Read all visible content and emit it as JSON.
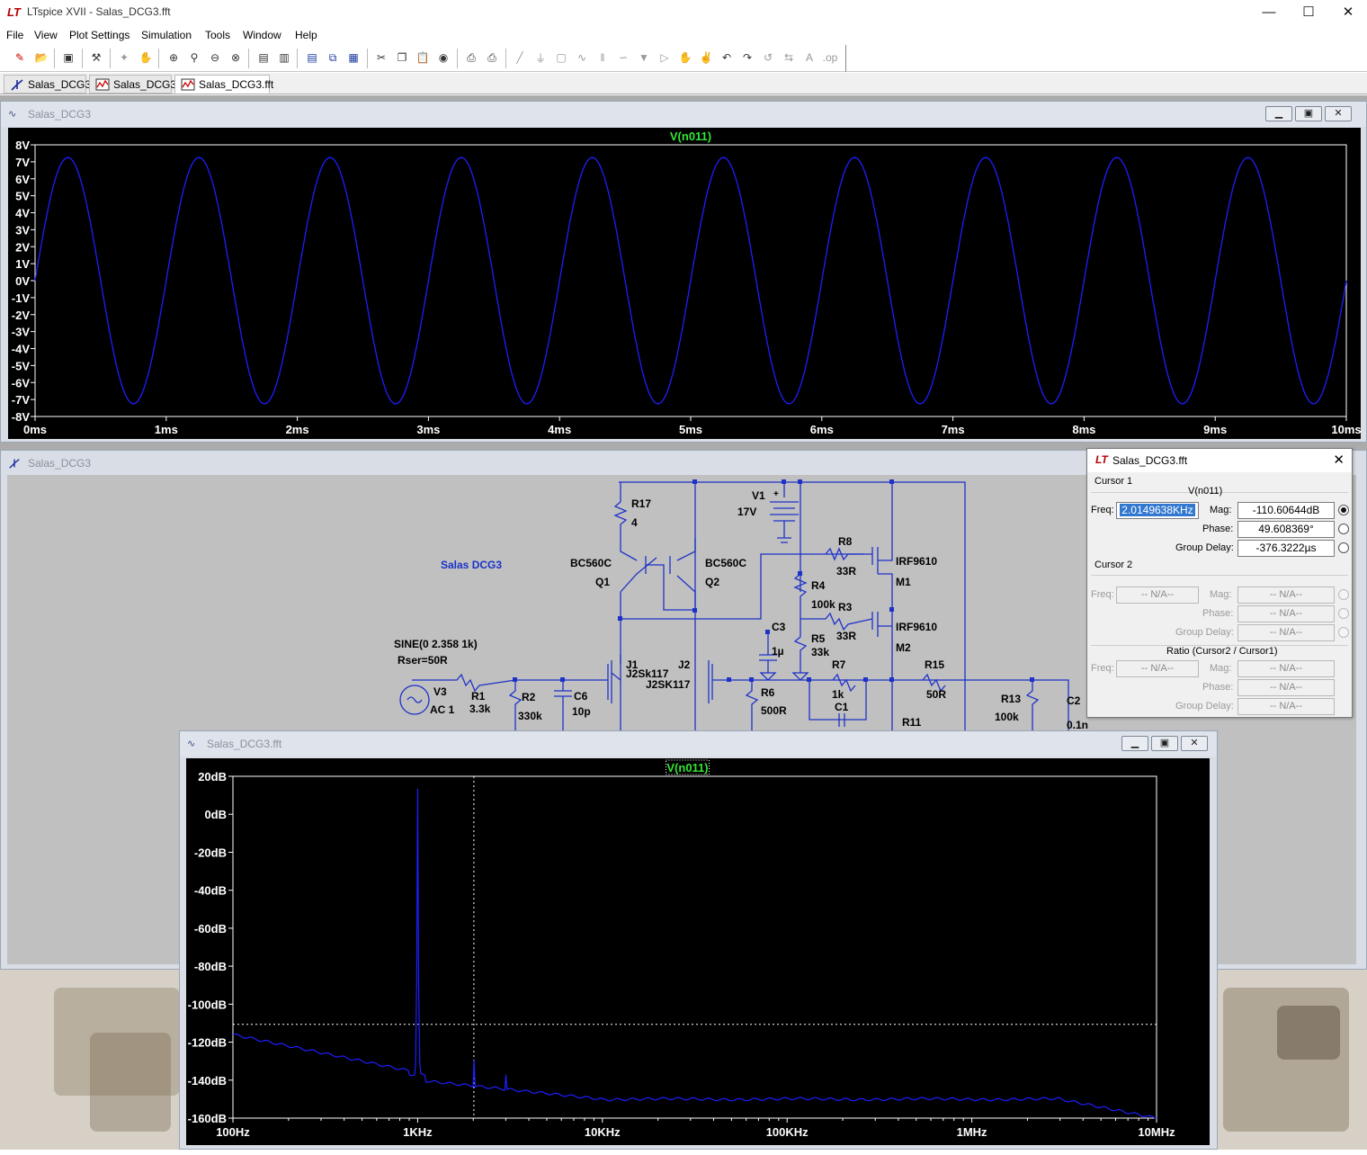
{
  "window": {
    "title": "LTspice XVII - Salas_DCG3.fft",
    "controls": [
      "minimize-icon",
      "maximize-icon",
      "close-icon"
    ]
  },
  "menu": [
    "File",
    "View",
    "Plot Settings",
    "Simulation",
    "Tools",
    "Window",
    "Help"
  ],
  "tabs": [
    {
      "label": "Salas_DCG3",
      "icon": "schematic-icon",
      "active": false
    },
    {
      "label": "Salas_DCG3",
      "icon": "waveform-icon",
      "active": false
    },
    {
      "label": "Salas_DCG3.fft",
      "icon": "waveform-icon",
      "active": true
    }
  ],
  "time_plot": {
    "window_title": "Salas_DCG3",
    "trace_label": "V(n011)",
    "trace_color": "#1e1eff",
    "y_ticks": [
      "8V",
      "7V",
      "6V",
      "5V",
      "4V",
      "3V",
      "2V",
      "1V",
      "0V",
      "-1V",
      "-2V",
      "-3V",
      "-4V",
      "-5V",
      "-6V",
      "-7V",
      "-8V"
    ],
    "x_ticks": [
      "0ms",
      "1ms",
      "2ms",
      "3ms",
      "4ms",
      "5ms",
      "6ms",
      "7ms",
      "8ms",
      "9ms",
      "10ms"
    ]
  },
  "schematic": {
    "window_title": "Salas_DCG3",
    "title_text": "Salas DCG3",
    "labels": {
      "r17": "R17",
      "r17v": "4",
      "v1": "V1",
      "v1v": "17V",
      "v1plus": "+",
      "bc1": "BC560C",
      "q1": "Q1",
      "bc2": "BC560C",
      "q2": "Q2",
      "r8": "R8",
      "r8v": "33R",
      "irf1": "IRF9610",
      "m1": "M1",
      "r4": "R4",
      "r4v": "100k",
      "r3": "R3",
      "r3v": "33R",
      "irf2": "IRF9610",
      "m2": "M2",
      "c3": "C3",
      "c3v": "1µ",
      "r5": "R5",
      "r5v": "33k",
      "sine": "SINE(0 2.358 1k)",
      "rser": "Rser=50R",
      "j1": "J1",
      "j1v": "J2Sk117",
      "j2": "J2",
      "j2v": "J2SK117",
      "r7": "R7",
      "r7v": "1k",
      "c1": "C1",
      "r15": "R15",
      "r15v": "50R",
      "v3": "V3",
      "v3v": "AC 1",
      "r1": "R1",
      "r1v": "3.3k",
      "r2": "R2",
      "r2v": "330k",
      "c6": "C6",
      "c6v": "10p",
      "r6": "R6",
      "r6v": "500R",
      "r11": "R11",
      "r13": "R13",
      "r13v": "100k",
      "c2": "C2",
      "c2v": "0.1n"
    }
  },
  "fft_plot": {
    "window_title": "Salas_DCG3.fft",
    "trace_label": "V(n011)",
    "y_ticks": [
      "20dB",
      "0dB",
      "-20dB",
      "-40dB",
      "-60dB",
      "-80dB",
      "-100dB",
      "-120dB",
      "-140dB",
      "-160dB"
    ],
    "x_ticks": [
      "100Hz",
      "1KHz",
      "10KHz",
      "100KHz",
      "1MHz",
      "10MHz"
    ]
  },
  "cursor_dialog": {
    "title": "Salas_DCG3.fft",
    "cursor1": {
      "heading": "Cursor 1",
      "trace": "V(n011)",
      "freq_label": "Freq:",
      "freq": "2.0149638KHz",
      "mag_label": "Mag:",
      "mag": "-110.60644dB",
      "phase_label": "Phase:",
      "phase": "49.608369°",
      "gd_label": "Group Delay:",
      "gd": "-376.3222µs"
    },
    "cursor2": {
      "heading": "Cursor 2",
      "freq_label": "Freq:",
      "freq": "-- N/A--",
      "mag_label": "Mag:",
      "mag": "-- N/A--",
      "phase_label": "Phase:",
      "phase": "-- N/A--",
      "gd_label": "Group Delay:",
      "gd": "-- N/A--"
    },
    "ratio": {
      "heading": "Ratio (Cursor2 / Cursor1)",
      "freq_label": "Freq:",
      "freq": "-- N/A--",
      "mag_label": "Mag:",
      "mag": "-- N/A--",
      "phase_label": "Phase:",
      "phase": "-- N/A--",
      "gd_label": "Group Delay:",
      "gd": "-- N/A--"
    }
  }
}
